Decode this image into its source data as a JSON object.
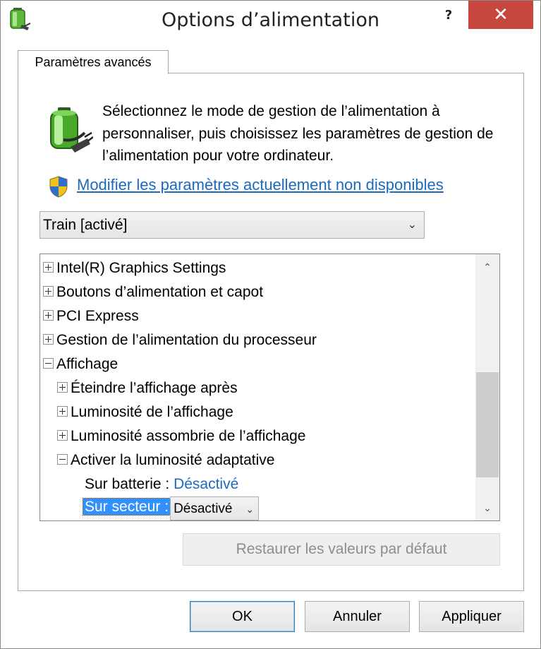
{
  "window": {
    "title": "Options d’alimentation",
    "help_label": "?",
    "close_label": "✕"
  },
  "tab": {
    "label": "Paramètres avancés"
  },
  "description": "Sélectionnez le mode de gestion de l’alimentation à personnaliser, puis choisissez les paramètres de gestion de l’alimentation pour votre ordinateur.",
  "link": {
    "label": "Modifier les paramètres actuellement non disponibles"
  },
  "plan_select": {
    "value": "Train [activé]"
  },
  "tree": {
    "items": [
      {
        "label": "Intel(R) Graphics Settings",
        "expanded": false
      },
      {
        "label": "Boutons d’alimentation et capot",
        "expanded": false
      },
      {
        "label": "PCI Express",
        "expanded": false
      },
      {
        "label": "Gestion de l’alimentation du processeur",
        "expanded": false
      },
      {
        "label": "Affichage",
        "expanded": true
      },
      {
        "label": "Éteindre l’affichage après",
        "expanded": false
      },
      {
        "label": "Luminosité de l’affichage",
        "expanded": false
      },
      {
        "label": "Luminosité assombrie de l’affichage",
        "expanded": false
      },
      {
        "label": "Activer la luminosité adaptative",
        "expanded": true
      }
    ],
    "battery": {
      "label": "Sur batterie :",
      "value": "Désactivé"
    },
    "plugged": {
      "label": "Sur secteur :",
      "value": "Désactivé"
    }
  },
  "restore_button": {
    "label": "Restaurer les valeurs par défaut"
  },
  "buttons": {
    "ok": "OK",
    "cancel": "Annuler",
    "apply": "Appliquer"
  },
  "colors": {
    "close": "#c7463d",
    "link": "#1a6bbf",
    "selection": "#3390ff"
  },
  "icons": [
    "battery-plug-icon",
    "shield-icon",
    "chevron-down-icon",
    "chevron-up-icon",
    "plus-icon",
    "minus-icon"
  ]
}
